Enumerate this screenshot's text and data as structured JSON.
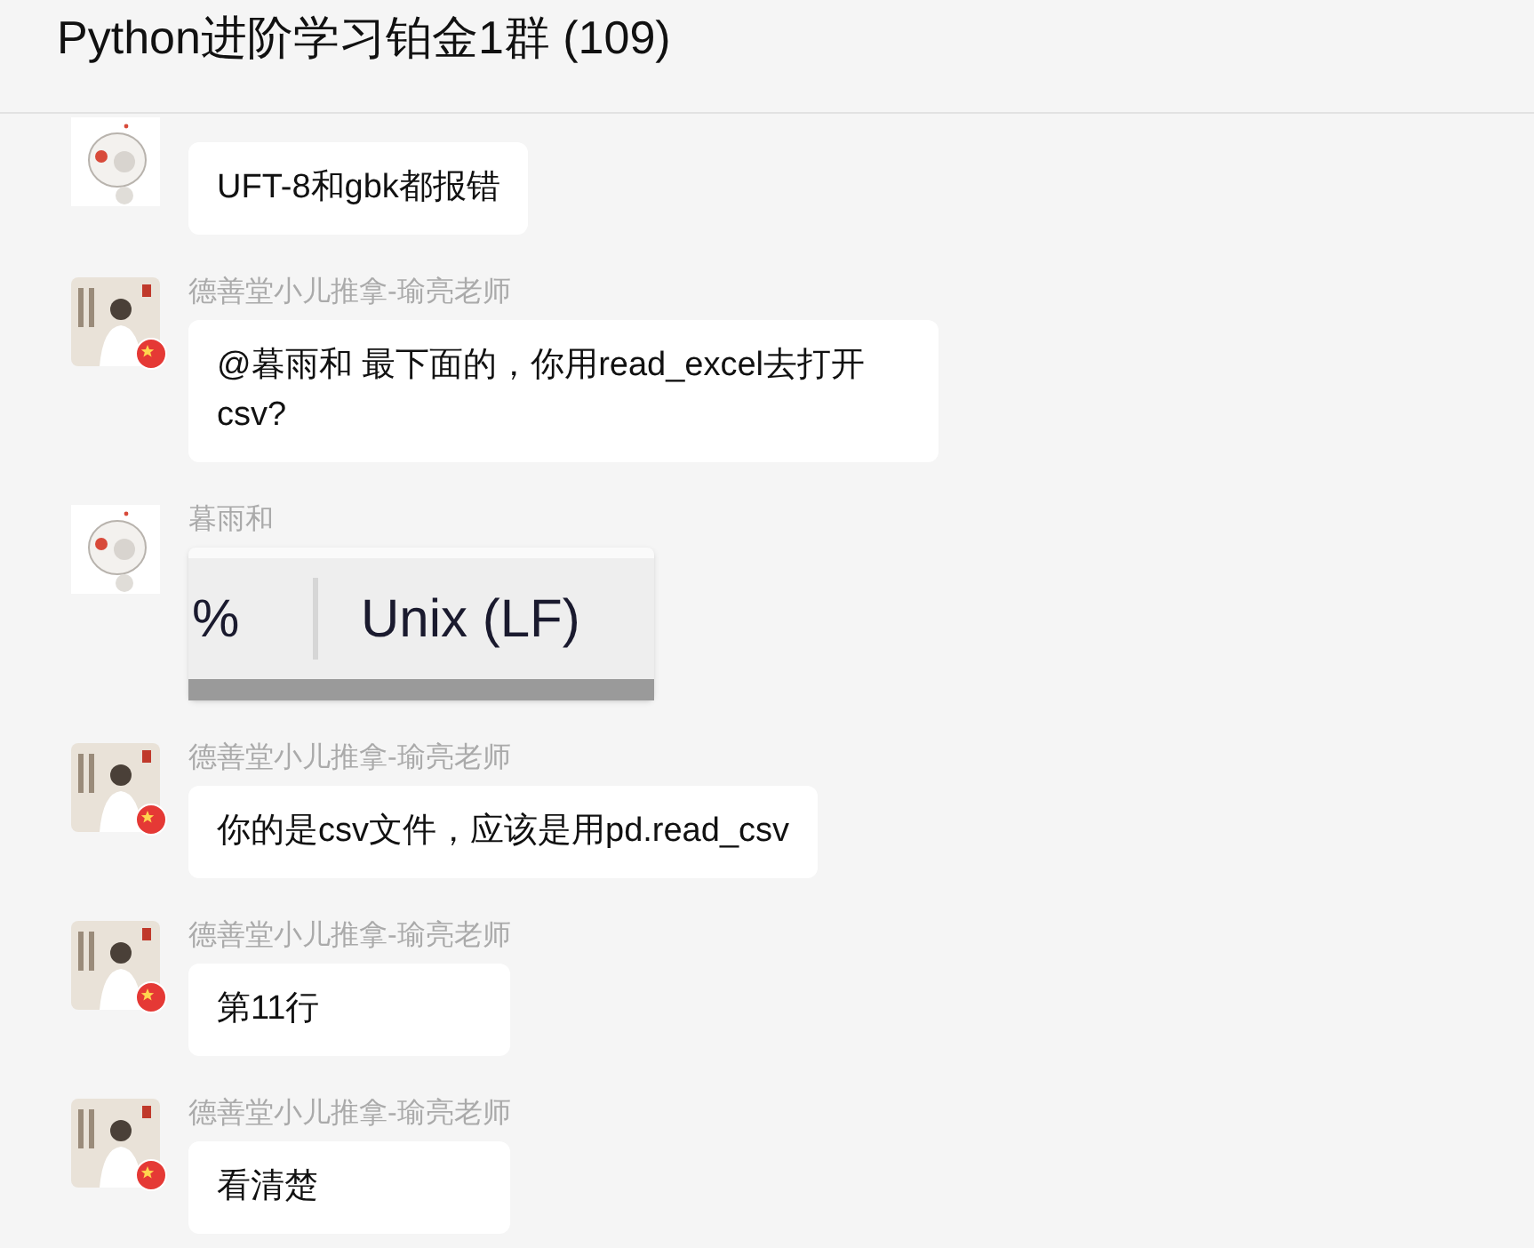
{
  "window": {
    "title": "Python进阶学习铂金1群 (109)"
  },
  "messages": [
    {
      "kind": "text",
      "avatar": {
        "kind": "sticker"
      },
      "text": "UFT-8和gbk都报错"
    },
    {
      "kind": "text",
      "avatar": {
        "kind": "person"
      },
      "sender": "德善堂小儿推拿-瑜亮老师",
      "text": "@暮雨和 最下面的，你用read_excel去打开csv?"
    },
    {
      "kind": "image",
      "avatar": {
        "kind": "sticker"
      },
      "sender": "暮雨和",
      "image": {
        "left_text": "%",
        "right_text": "Unix (LF)"
      }
    },
    {
      "kind": "text",
      "avatar": {
        "kind": "person"
      },
      "sender": "德善堂小儿推拿-瑜亮老师",
      "text": "你的是csv文件，应该是用pd.read_csv"
    },
    {
      "kind": "text",
      "avatar": {
        "kind": "person"
      },
      "sender": "德善堂小儿推拿-瑜亮老师",
      "text": "第11行"
    },
    {
      "kind": "text",
      "avatar": {
        "kind": "person"
      },
      "sender": "德善堂小儿推拿-瑜亮老师",
      "text": "看清楚"
    }
  ]
}
